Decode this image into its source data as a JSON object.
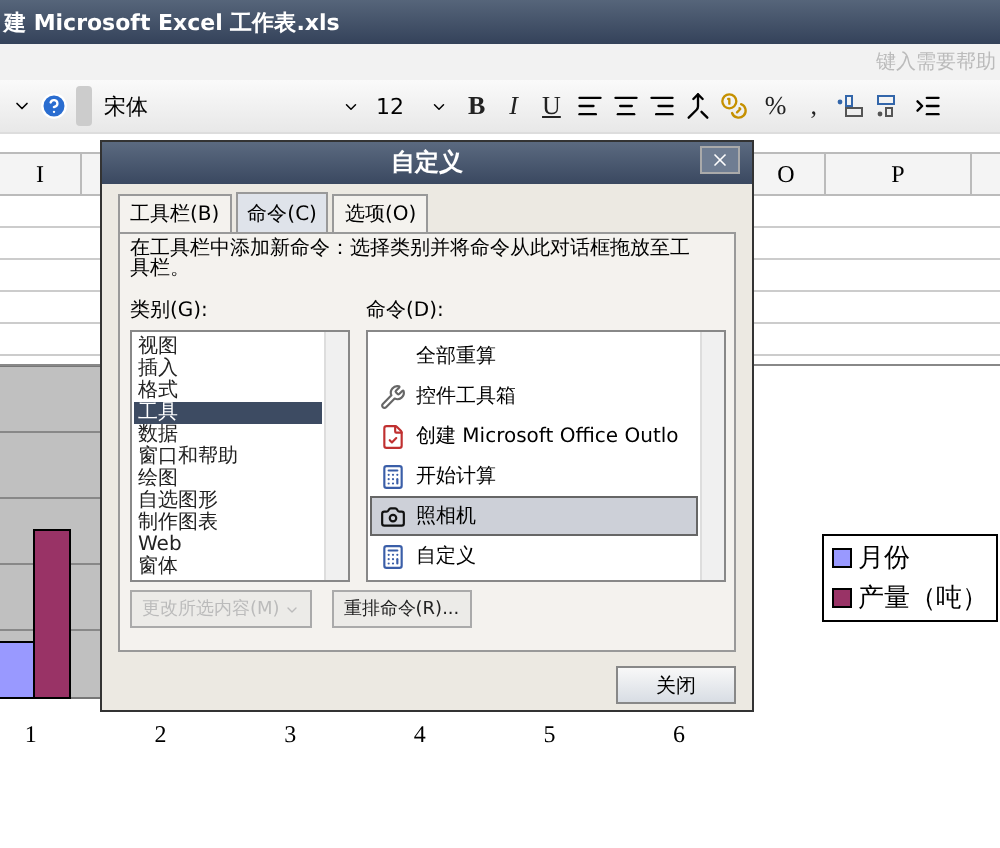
{
  "window": {
    "title": "建 Microsoft Excel 工作表.xls"
  },
  "help": {
    "placeholder": "键入需要帮助"
  },
  "toolbar": [
    {
      "kind": "caret"
    },
    {
      "kind": "help"
    },
    {
      "kind": "grip"
    },
    {
      "kind": "font",
      "label": "宋体"
    },
    {
      "kind": "size",
      "label": "12"
    },
    {
      "kind": "bold",
      "label": "B"
    },
    {
      "kind": "italic",
      "label": "I"
    },
    {
      "kind": "underline",
      "label": "U"
    },
    {
      "kind": "align-left"
    },
    {
      "kind": "align-center"
    },
    {
      "kind": "align-right"
    },
    {
      "kind": "merge"
    },
    {
      "kind": "currency"
    },
    {
      "kind": "percent",
      "label": "%"
    },
    {
      "kind": "comma",
      "label": ","
    },
    {
      "kind": "inc-decimal"
    },
    {
      "kind": "dec-decimal"
    },
    {
      "kind": "indent"
    }
  ],
  "columns": [
    "I",
    "O",
    "P"
  ],
  "chart": {
    "categories": [
      "1",
      "2",
      "3",
      "4",
      "5",
      "6"
    ],
    "legend": [
      {
        "label": "月份",
        "color": "#9999ff"
      },
      {
        "label": "产量（吨）",
        "color": "#993366"
      }
    ]
  },
  "dialog": {
    "title": "自定义",
    "tabs": [
      {
        "label": "工具栏(B)",
        "selected": false
      },
      {
        "label": "命令(C)",
        "selected": true
      },
      {
        "label": "选项(O)",
        "selected": false
      }
    ],
    "description": "在工具栏中添加新命令：选择类别并将命令从此对话框拖放至工具栏。",
    "categories_label": "类别(G):",
    "commands_label": "命令(D):",
    "categories": [
      {
        "label": "视图",
        "selected": false
      },
      {
        "label": "插入",
        "selected": false
      },
      {
        "label": "格式",
        "selected": false
      },
      {
        "label": "工具",
        "selected": true
      },
      {
        "label": "数据",
        "selected": false
      },
      {
        "label": "窗口和帮助",
        "selected": false
      },
      {
        "label": "绘图",
        "selected": false
      },
      {
        "label": "自选图形",
        "selected": false
      },
      {
        "label": "制作图表",
        "selected": false
      },
      {
        "label": "Web",
        "selected": false
      },
      {
        "label": "窗体",
        "selected": false
      }
    ],
    "commands": [
      {
        "label": "全部重算",
        "kind": "plain",
        "selected": false
      },
      {
        "label": "控件工具箱",
        "kind": "tools",
        "selected": false
      },
      {
        "label": "创建 Microsoft Office Outlo",
        "kind": "outlook",
        "selected": false
      },
      {
        "label": "开始计算",
        "kind": "calc",
        "selected": false
      },
      {
        "label": "照相机",
        "kind": "camera",
        "selected": true
      },
      {
        "label": "自定义",
        "kind": "calc",
        "selected": false
      }
    ],
    "modify_button": {
      "label": "更改所选内容(M)",
      "disabled": true
    },
    "rearrange_button": {
      "label": "重排命令(R)..."
    },
    "close_button": {
      "label": "关闭"
    }
  }
}
